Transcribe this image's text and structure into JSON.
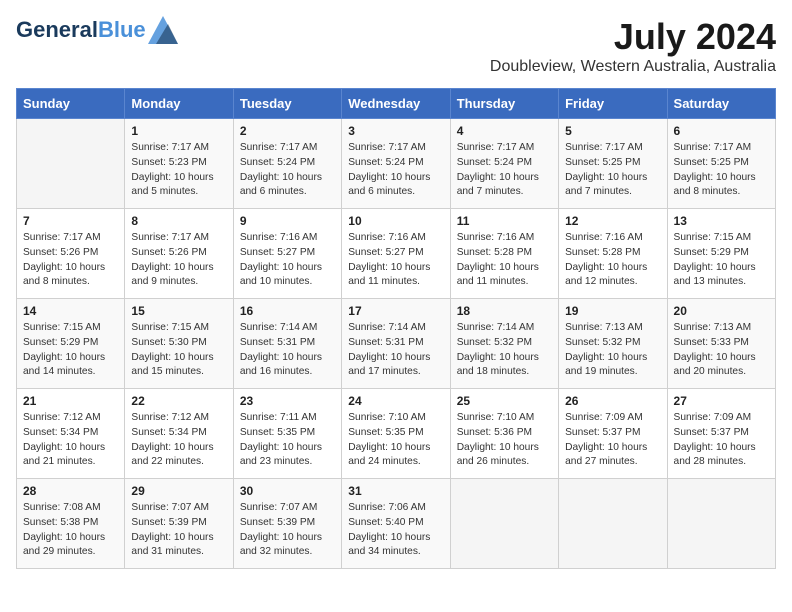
{
  "header": {
    "logo_line1": "General",
    "logo_line2": "Blue",
    "month": "July 2024",
    "location": "Doubleview, Western Australia, Australia"
  },
  "days_of_week": [
    "Sunday",
    "Monday",
    "Tuesday",
    "Wednesday",
    "Thursday",
    "Friday",
    "Saturday"
  ],
  "weeks": [
    [
      {
        "num": "",
        "info": ""
      },
      {
        "num": "1",
        "info": "Sunrise: 7:17 AM\nSunset: 5:23 PM\nDaylight: 10 hours\nand 5 minutes."
      },
      {
        "num": "2",
        "info": "Sunrise: 7:17 AM\nSunset: 5:24 PM\nDaylight: 10 hours\nand 6 minutes."
      },
      {
        "num": "3",
        "info": "Sunrise: 7:17 AM\nSunset: 5:24 PM\nDaylight: 10 hours\nand 6 minutes."
      },
      {
        "num": "4",
        "info": "Sunrise: 7:17 AM\nSunset: 5:24 PM\nDaylight: 10 hours\nand 7 minutes."
      },
      {
        "num": "5",
        "info": "Sunrise: 7:17 AM\nSunset: 5:25 PM\nDaylight: 10 hours\nand 7 minutes."
      },
      {
        "num": "6",
        "info": "Sunrise: 7:17 AM\nSunset: 5:25 PM\nDaylight: 10 hours\nand 8 minutes."
      }
    ],
    [
      {
        "num": "7",
        "info": "Sunrise: 7:17 AM\nSunset: 5:26 PM\nDaylight: 10 hours\nand 8 minutes."
      },
      {
        "num": "8",
        "info": "Sunrise: 7:17 AM\nSunset: 5:26 PM\nDaylight: 10 hours\nand 9 minutes."
      },
      {
        "num": "9",
        "info": "Sunrise: 7:16 AM\nSunset: 5:27 PM\nDaylight: 10 hours\nand 10 minutes."
      },
      {
        "num": "10",
        "info": "Sunrise: 7:16 AM\nSunset: 5:27 PM\nDaylight: 10 hours\nand 11 minutes."
      },
      {
        "num": "11",
        "info": "Sunrise: 7:16 AM\nSunset: 5:28 PM\nDaylight: 10 hours\nand 11 minutes."
      },
      {
        "num": "12",
        "info": "Sunrise: 7:16 AM\nSunset: 5:28 PM\nDaylight: 10 hours\nand 12 minutes."
      },
      {
        "num": "13",
        "info": "Sunrise: 7:15 AM\nSunset: 5:29 PM\nDaylight: 10 hours\nand 13 minutes."
      }
    ],
    [
      {
        "num": "14",
        "info": "Sunrise: 7:15 AM\nSunset: 5:29 PM\nDaylight: 10 hours\nand 14 minutes."
      },
      {
        "num": "15",
        "info": "Sunrise: 7:15 AM\nSunset: 5:30 PM\nDaylight: 10 hours\nand 15 minutes."
      },
      {
        "num": "16",
        "info": "Sunrise: 7:14 AM\nSunset: 5:31 PM\nDaylight: 10 hours\nand 16 minutes."
      },
      {
        "num": "17",
        "info": "Sunrise: 7:14 AM\nSunset: 5:31 PM\nDaylight: 10 hours\nand 17 minutes."
      },
      {
        "num": "18",
        "info": "Sunrise: 7:14 AM\nSunset: 5:32 PM\nDaylight: 10 hours\nand 18 minutes."
      },
      {
        "num": "19",
        "info": "Sunrise: 7:13 AM\nSunset: 5:32 PM\nDaylight: 10 hours\nand 19 minutes."
      },
      {
        "num": "20",
        "info": "Sunrise: 7:13 AM\nSunset: 5:33 PM\nDaylight: 10 hours\nand 20 minutes."
      }
    ],
    [
      {
        "num": "21",
        "info": "Sunrise: 7:12 AM\nSunset: 5:34 PM\nDaylight: 10 hours\nand 21 minutes."
      },
      {
        "num": "22",
        "info": "Sunrise: 7:12 AM\nSunset: 5:34 PM\nDaylight: 10 hours\nand 22 minutes."
      },
      {
        "num": "23",
        "info": "Sunrise: 7:11 AM\nSunset: 5:35 PM\nDaylight: 10 hours\nand 23 minutes."
      },
      {
        "num": "24",
        "info": "Sunrise: 7:10 AM\nSunset: 5:35 PM\nDaylight: 10 hours\nand 24 minutes."
      },
      {
        "num": "25",
        "info": "Sunrise: 7:10 AM\nSunset: 5:36 PM\nDaylight: 10 hours\nand 26 minutes."
      },
      {
        "num": "26",
        "info": "Sunrise: 7:09 AM\nSunset: 5:37 PM\nDaylight: 10 hours\nand 27 minutes."
      },
      {
        "num": "27",
        "info": "Sunrise: 7:09 AM\nSunset: 5:37 PM\nDaylight: 10 hours\nand 28 minutes."
      }
    ],
    [
      {
        "num": "28",
        "info": "Sunrise: 7:08 AM\nSunset: 5:38 PM\nDaylight: 10 hours\nand 29 minutes."
      },
      {
        "num": "29",
        "info": "Sunrise: 7:07 AM\nSunset: 5:39 PM\nDaylight: 10 hours\nand 31 minutes."
      },
      {
        "num": "30",
        "info": "Sunrise: 7:07 AM\nSunset: 5:39 PM\nDaylight: 10 hours\nand 32 minutes."
      },
      {
        "num": "31",
        "info": "Sunrise: 7:06 AM\nSunset: 5:40 PM\nDaylight: 10 hours\nand 34 minutes."
      },
      {
        "num": "",
        "info": ""
      },
      {
        "num": "",
        "info": ""
      },
      {
        "num": "",
        "info": ""
      }
    ]
  ]
}
